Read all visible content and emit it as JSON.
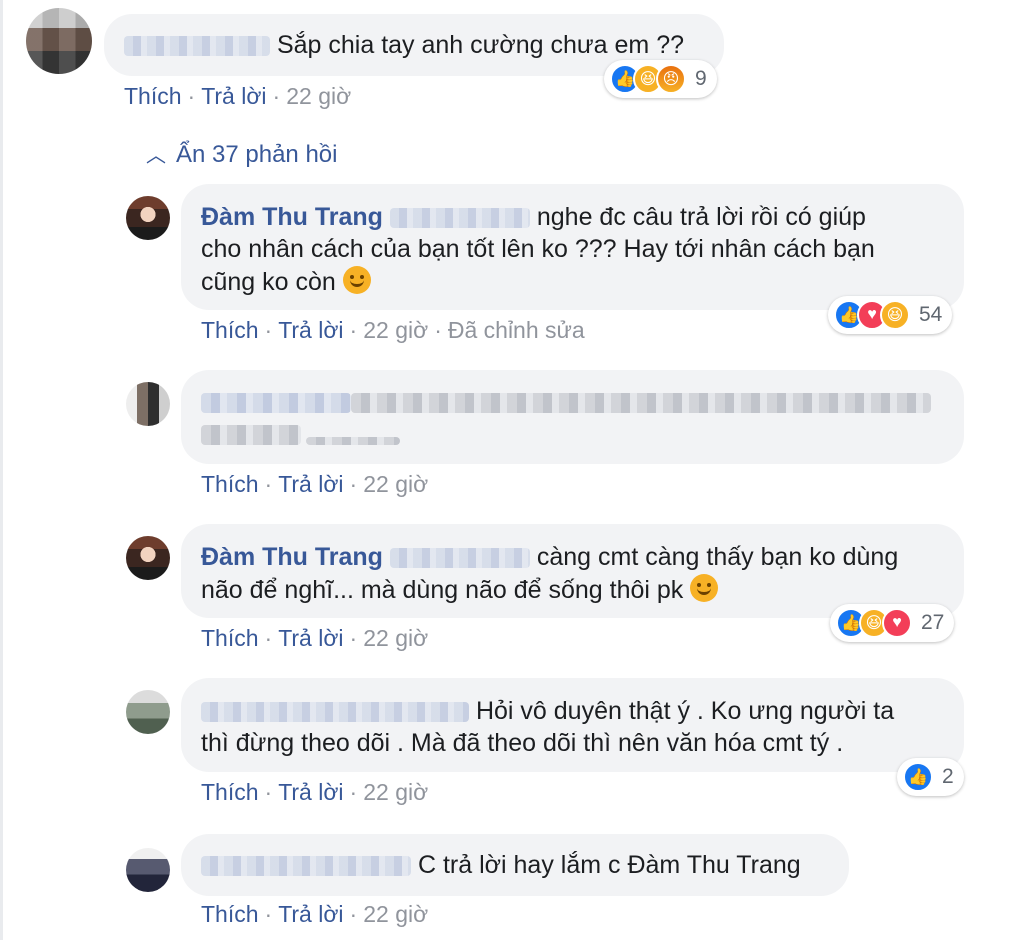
{
  "toggle_replies": {
    "icon": "chevron-up-icon",
    "label": "Ẩn 37 phản hồi"
  },
  "actions": {
    "like": "Thích",
    "reply": "Trả lời",
    "sep": "·"
  },
  "comments": [
    {
      "text": "Sắp chia tay anh cường chưa em ??",
      "time": "22 giờ",
      "reaction_count": "9",
      "reactions": [
        "like",
        "haha",
        "angry"
      ]
    },
    {
      "author": "Đàm Thu Trang",
      "line1": "nghe đc câu trả lời rồi có giúp",
      "line2": "cho nhân cách của bạn tốt lên ko ??? Hay tới nhân cách bạn",
      "line3": "cũng ko còn",
      "time": "22 giờ",
      "edited": "Đã chỉnh sửa",
      "reaction_count": "54",
      "reactions": [
        "like",
        "love",
        "haha"
      ]
    },
    {
      "time": "22 giờ"
    },
    {
      "author": "Đàm Thu Trang",
      "line1": "càng cmt càng thấy bạn ko dùng",
      "line2": "não để nghĩ... mà dùng não để sống thôi pk",
      "time": "22 giờ",
      "reaction_count": "27",
      "reactions": [
        "like",
        "haha",
        "love"
      ]
    },
    {
      "line1": "Hỏi vô duyên thật ý . Ko ưng người ta",
      "line2": "thì đừng theo dõi . Mà đã theo dõi thì nên văn hóa cmt tý .",
      "time": "22 giờ",
      "reaction_count": "2",
      "reactions": [
        "like"
      ]
    },
    {
      "text": "C trả lời hay lắm c Đàm Thu Trang",
      "time": "22 giờ"
    }
  ],
  "colors": {
    "link": "#385898",
    "bubble": "#f2f3f5",
    "meta": "#90949c",
    "like": "#1877f2",
    "love": "#f33e58",
    "haha": "#f7b125"
  },
  "icons": {
    "like": "like-icon",
    "love": "love-icon",
    "haha": "haha-icon",
    "angry": "angry-icon",
    "smile": "smiling-emoji-icon"
  }
}
